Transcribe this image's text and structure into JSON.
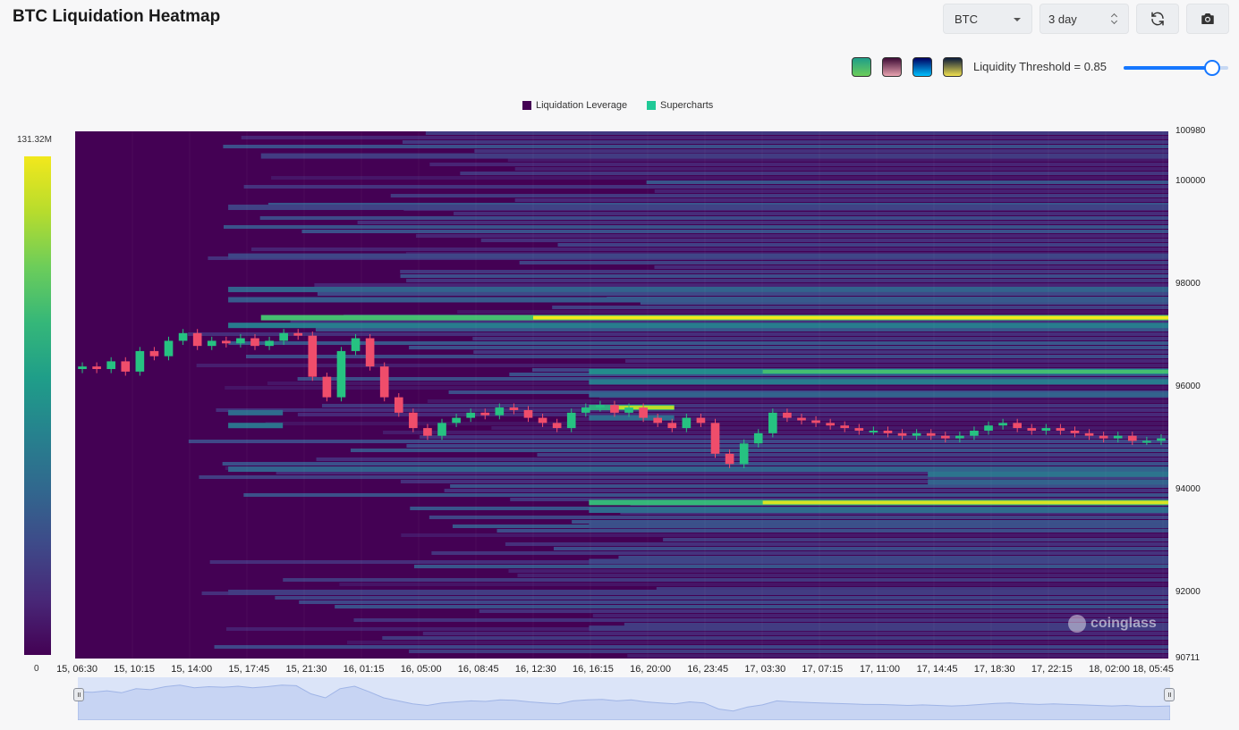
{
  "header": {
    "title": "BTC Liquidation Heatmap"
  },
  "controls": {
    "coin": "BTC",
    "range": "3 day",
    "refresh_icon": "refresh-icon",
    "camera_icon": "camera-icon"
  },
  "palettes": [
    {
      "icon": "palette-viridis",
      "from": "#1f9e89",
      "to": "#6ccd5a"
    },
    {
      "icon": "palette-pink",
      "from": "#3d0b35",
      "to": "#e8a3b0"
    },
    {
      "icon": "palette-blue",
      "from": "#000060",
      "to": "#00c0ff"
    },
    {
      "icon": "palette-cividis",
      "from": "#0a1a3a",
      "to": "#f0e050"
    }
  ],
  "threshold": {
    "label": "Liquidity Threshold = 0.85",
    "value": 0.85
  },
  "chart_data": {
    "type": "heatmap",
    "title": "",
    "legend": [
      {
        "name": "Liquidation Leverage",
        "color": "#440154"
      },
      {
        "name": "Supercharts",
        "color": "#20c997"
      }
    ],
    "colorbar": {
      "max_label": "131.32M",
      "min_label": "0",
      "max": 131.32,
      "min": 0
    },
    "y_range": [
      90711,
      100980
    ],
    "y_ticks": [
      "100980",
      "100000",
      "98000",
      "96000",
      "94000",
      "92000",
      "90711"
    ],
    "y_tick_values": [
      100980,
      100000,
      98000,
      96000,
      94000,
      92000,
      90711
    ],
    "x_ticks": [
      "15, 06:30",
      "15, 10:15",
      "15, 14:00",
      "15, 17:45",
      "15, 21:30",
      "16, 01:15",
      "16, 05:00",
      "16, 08:45",
      "16, 12:30",
      "16, 16:15",
      "16, 20:00",
      "16, 23:45",
      "17, 03:30",
      "17, 07:15",
      "17, 11:00",
      "17, 14:45",
      "17, 18:30",
      "17, 22:15",
      "18, 02:00",
      "18, 05:45"
    ],
    "price_series": {
      "name": "BTC price",
      "x_range": [
        "15, 06:30",
        "18, 07:00"
      ],
      "values": [
        96400,
        96350,
        96500,
        96300,
        96700,
        96600,
        96900,
        97050,
        96800,
        96900,
        96850,
        96950,
        96800,
        96900,
        97050,
        97000,
        96200,
        95800,
        96700,
        96950,
        96400,
        95800,
        95500,
        95200,
        95050,
        95300,
        95400,
        95500,
        95450,
        95600,
        95550,
        95400,
        95300,
        95200,
        95500,
        95600,
        95650,
        95500,
        95600,
        95400,
        95300,
        95200,
        95400,
        95300,
        94700,
        94500,
        94900,
        95100,
        95500,
        95400,
        95350,
        95300,
        95250,
        95200,
        95150,
        95150,
        95100,
        95050,
        95100,
        95050,
        95000,
        95050,
        95150,
        95250,
        95300,
        95200,
        95150,
        95200,
        95150,
        95100,
        95050,
        95000,
        95050,
        94950,
        94950,
        95000
      ]
    },
    "bands": [
      {
        "price": 97350,
        "intensity": 1.0,
        "start": 0.17
      },
      {
        "price": 97200,
        "intensity": 0.6,
        "start": 0.14
      },
      {
        "price": 97900,
        "intensity": 0.45,
        "start": 0.14
      },
      {
        "price": 97700,
        "intensity": 0.4,
        "start": 0.14
      },
      {
        "price": 96300,
        "intensity": 0.7,
        "start": 0.47
      },
      {
        "price": 96100,
        "intensity": 0.6,
        "start": 0.47
      },
      {
        "price": 95850,
        "intensity": 0.45,
        "start": 0.47
      },
      {
        "price": 95600,
        "intensity": 0.9,
        "start": 0.47,
        "end": 0.548
      },
      {
        "price": 95400,
        "intensity": 0.5,
        "start": 0.47,
        "end": 0.548
      },
      {
        "price": 95500,
        "intensity": 0.5,
        "start": 0.14,
        "end": 0.19
      },
      {
        "price": 95250,
        "intensity": 0.55,
        "start": 0.14,
        "end": 0.19
      },
      {
        "price": 94400,
        "intensity": 0.45,
        "start": 0.14
      },
      {
        "price": 94300,
        "intensity": 0.55,
        "start": 0.78
      },
      {
        "price": 94150,
        "intensity": 0.45,
        "start": 0.78
      },
      {
        "price": 93750,
        "intensity": 0.95,
        "start": 0.47
      },
      {
        "price": 93600,
        "intensity": 0.5,
        "start": 0.47
      },
      {
        "price": 93300,
        "intensity": 0.35,
        "start": 0.47
      },
      {
        "price": 98550,
        "intensity": 0.3,
        "start": 0.14
      },
      {
        "price": 99500,
        "intensity": 0.28,
        "start": 0.14
      },
      {
        "price": 100500,
        "intensity": 0.25,
        "start": 0.17
      },
      {
        "price": 92600,
        "intensity": 0.3,
        "start": 0.47
      },
      {
        "price": 92000,
        "intensity": 0.25,
        "start": 0.14
      },
      {
        "price": 91300,
        "intensity": 0.25,
        "start": 0.47
      }
    ],
    "grid": true,
    "legend_position": "top-center"
  },
  "watermark": "coinglass"
}
